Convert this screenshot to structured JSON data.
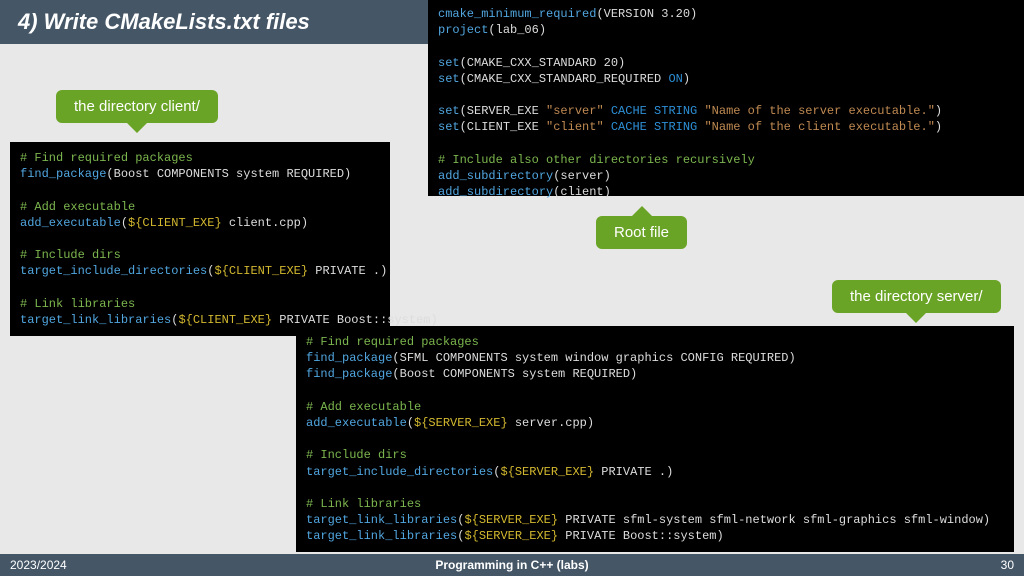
{
  "title": "4) Write CMakeLists.txt files",
  "callouts": {
    "client": "the directory client/",
    "root": "Root file",
    "server": "the directory server/"
  },
  "footer": {
    "left": "2023/2024",
    "center": "Programming in C++ (labs)",
    "page": "30"
  },
  "root": {
    "l1a": "cmake_minimum_required",
    "l1b": "(VERSION 3.20)",
    "l2a": "project",
    "l2b": "(lab_06)",
    "l3a": "set",
    "l3b": "(CMAKE_CXX_STANDARD 20)",
    "l4a": "set",
    "l4b": "(CMAKE_CXX_STANDARD_REQUIRED ",
    "l4c": "ON",
    "l4d": ")",
    "l5a": "set",
    "l5b": "(SERVER_EXE ",
    "l5c": "\"server\"",
    "l5d": " CACHE STRING ",
    "l5e": "\"Name of the server executable.\"",
    "l5f": ")",
    "l6a": "set",
    "l6b": "(CLIENT_EXE ",
    "l6c": "\"client\"",
    "l6d": " CACHE STRING ",
    "l6e": "\"Name of the client executable.\"",
    "l6f": ")",
    "l7": "# Include also other directories recursively",
    "l8a": "add_subdirectory",
    "l8b": "(server)",
    "l9a": "add_subdirectory",
    "l9b": "(client)"
  },
  "client": {
    "c1": "# Find required packages",
    "l1a": "find_package",
    "l1b": "(Boost COMPONENTS system REQUIRED)",
    "c2": "# Add executable",
    "l2a": "add_executable",
    "l2b": "(",
    "l2c": "${CLIENT_EXE}",
    "l2d": " client.cpp)",
    "c3": "# Include dirs",
    "l3a": "target_include_directories",
    "l3b": "(",
    "l3c": "${CLIENT_EXE}",
    "l3d": " PRIVATE .)",
    "c4": "# Link libraries",
    "l4a": "target_link_libraries",
    "l4b": "(",
    "l4c": "${CLIENT_EXE}",
    "l4d": " PRIVATE Boost::system)"
  },
  "server": {
    "c1": "# Find required packages",
    "l1a": "find_package",
    "l1b": "(SFML COMPONENTS system window graphics CONFIG REQUIRED)",
    "l2a": "find_package",
    "l2b": "(Boost COMPONENTS system REQUIRED)",
    "c2": "# Add executable",
    "l3a": "add_executable",
    "l3b": "(",
    "l3c": "${SERVER_EXE}",
    "l3d": " server.cpp)",
    "c3": "# Include dirs",
    "l4a": "target_include_directories",
    "l4b": "(",
    "l4c": "${SERVER_EXE}",
    "l4d": " PRIVATE .)",
    "c4": "# Link libraries",
    "l5a": "target_link_libraries",
    "l5b": "(",
    "l5c": "${SERVER_EXE}",
    "l5d": " PRIVATE sfml-system sfml-network sfml-graphics sfml-window)",
    "l6a": "target_link_libraries",
    "l6b": "(",
    "l6c": "${SERVER_EXE}",
    "l6d": " PRIVATE Boost::system)"
  }
}
